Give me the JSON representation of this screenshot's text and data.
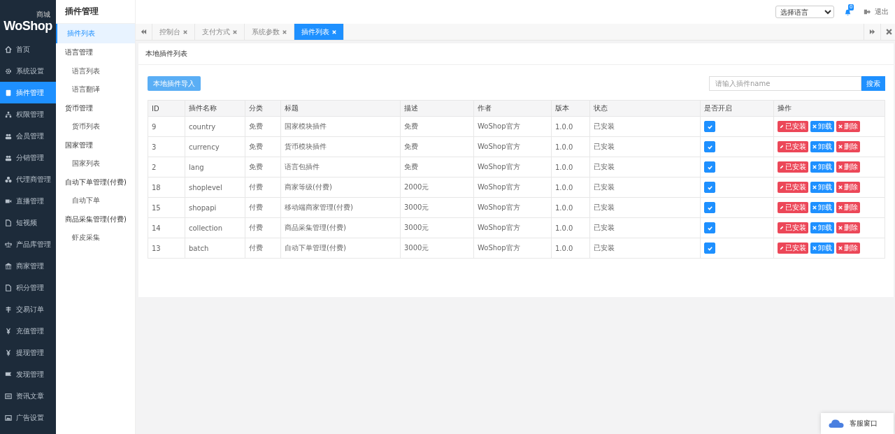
{
  "logo": {
    "text": "WoShop",
    "badge": "商城"
  },
  "sidebar": {
    "items": [
      {
        "label": "首页",
        "selected": false
      },
      {
        "label": "系统设置",
        "selected": false
      },
      {
        "label": "插件管理",
        "selected": true
      },
      {
        "label": "权限管理",
        "selected": false
      },
      {
        "label": "会员管理",
        "selected": false
      },
      {
        "label": "分销管理",
        "selected": false
      },
      {
        "label": "代理商管理",
        "selected": false
      },
      {
        "label": "直播管理",
        "selected": false
      },
      {
        "label": "短视频",
        "selected": false
      },
      {
        "label": "产品库管理",
        "selected": false
      },
      {
        "label": "商家管理",
        "selected": false
      },
      {
        "label": "积分管理",
        "selected": false
      },
      {
        "label": "交易订单",
        "selected": false
      },
      {
        "label": "充值管理",
        "selected": false
      },
      {
        "label": "提现管理",
        "selected": false
      },
      {
        "label": "发现管理",
        "selected": false
      },
      {
        "label": "资讯文章",
        "selected": false
      },
      {
        "label": "广告设置",
        "selected": false
      }
    ]
  },
  "submenu": {
    "title": "插件管理",
    "items": [
      {
        "kind": "link",
        "label": "插件列表",
        "selected": true
      },
      {
        "kind": "group",
        "label": "语言管理"
      },
      {
        "kind": "link",
        "label": "语言列表",
        "selected": false
      },
      {
        "kind": "link",
        "label": "语言翻译",
        "selected": false
      },
      {
        "kind": "group",
        "label": "货币管理"
      },
      {
        "kind": "link",
        "label": "货币列表",
        "selected": false
      },
      {
        "kind": "group",
        "label": "国家管理"
      },
      {
        "kind": "link",
        "label": "国家列表",
        "selected": false
      },
      {
        "kind": "group",
        "label": "自动下单管理(付费)"
      },
      {
        "kind": "link",
        "label": "自动下单",
        "selected": false
      },
      {
        "kind": "group",
        "label": "商品采集管理(付费)"
      },
      {
        "kind": "link",
        "label": "虾皮采集",
        "selected": false
      }
    ]
  },
  "header": {
    "language_select": "选择语言",
    "notifications": "0",
    "logout": "退出"
  },
  "tabs": [
    {
      "label": "控制台",
      "selected": false
    },
    {
      "label": "支付方式",
      "selected": false
    },
    {
      "label": "系统参数",
      "selected": false
    },
    {
      "label": "插件列表",
      "selected": true
    }
  ],
  "panel": {
    "title": "本地插件列表",
    "import_button": "本地插件导入",
    "search": {
      "placeholder": "请输入插件name",
      "button": "搜索"
    }
  },
  "table": {
    "columns": [
      "ID",
      "插件名称",
      "分类",
      "标题",
      "描述",
      "作者",
      "版本",
      "状态",
      "是否开启",
      "操作"
    ],
    "rows": [
      {
        "id": "9",
        "name": "country",
        "category": "免费",
        "title": "国家模块插件",
        "description": "免费",
        "author": "WoShop官方",
        "version": "1.0.0",
        "status": "已安装",
        "enabled": true,
        "actions": [
          {
            "kind": "installed",
            "label": "已安装"
          },
          {
            "kind": "uninstall",
            "label": "卸载"
          },
          {
            "kind": "delete",
            "label": "删除"
          }
        ]
      },
      {
        "id": "3",
        "name": "currency",
        "category": "免费",
        "title": "货币模块插件",
        "description": "免费",
        "author": "WoShop官方",
        "version": "1.0.0",
        "status": "已安装",
        "enabled": true,
        "actions": [
          {
            "kind": "installed",
            "label": "已安装"
          },
          {
            "kind": "uninstall",
            "label": "卸载"
          },
          {
            "kind": "delete",
            "label": "删除"
          }
        ]
      },
      {
        "id": "2",
        "name": "lang",
        "category": "免费",
        "title": "语言包插件",
        "description": "免费",
        "author": "WoShop官方",
        "version": "1.0.0",
        "status": "已安装",
        "enabled": true,
        "actions": [
          {
            "kind": "installed",
            "label": "已安装"
          },
          {
            "kind": "uninstall",
            "label": "卸载"
          },
          {
            "kind": "delete",
            "label": "删除"
          }
        ]
      },
      {
        "id": "18",
        "name": "shoplevel",
        "category": "付费",
        "title": "商家等级(付费)",
        "description": "2000元",
        "author": "WoShop官方",
        "version": "1.0.0",
        "status": "已安装",
        "enabled": true,
        "actions": [
          {
            "kind": "installed",
            "label": "已安装"
          },
          {
            "kind": "uninstall",
            "label": "卸载"
          },
          {
            "kind": "delete",
            "label": "删除"
          }
        ]
      },
      {
        "id": "15",
        "name": "shopapi",
        "category": "付费",
        "title": "移动端商家管理(付费)",
        "description": "3000元",
        "author": "WoShop官方",
        "version": "1.0.0",
        "status": "已安装",
        "enabled": true,
        "actions": [
          {
            "kind": "installed",
            "label": "已安装"
          },
          {
            "kind": "uninstall",
            "label": "卸载"
          },
          {
            "kind": "delete",
            "label": "删除"
          }
        ]
      },
      {
        "id": "14",
        "name": "collection",
        "category": "付费",
        "title": "商品采集管理(付费)",
        "description": "3000元",
        "author": "WoShop官方",
        "version": "1.0.0",
        "status": "已安装",
        "enabled": true,
        "actions": [
          {
            "kind": "installed",
            "label": "已安装"
          },
          {
            "kind": "uninstall",
            "label": "卸载"
          },
          {
            "kind": "delete",
            "label": "删除"
          }
        ]
      },
      {
        "id": "13",
        "name": "batch",
        "category": "付费",
        "title": "自动下单管理(付费)",
        "description": "3000元",
        "author": "WoShop官方",
        "version": "1.0.0",
        "status": "已安装",
        "enabled": true,
        "actions": [
          {
            "kind": "installed",
            "label": "已安装"
          },
          {
            "kind": "uninstall",
            "label": "卸载"
          },
          {
            "kind": "delete",
            "label": "删除"
          }
        ]
      }
    ]
  },
  "chat_widget": {
    "label": "客服窗口"
  }
}
